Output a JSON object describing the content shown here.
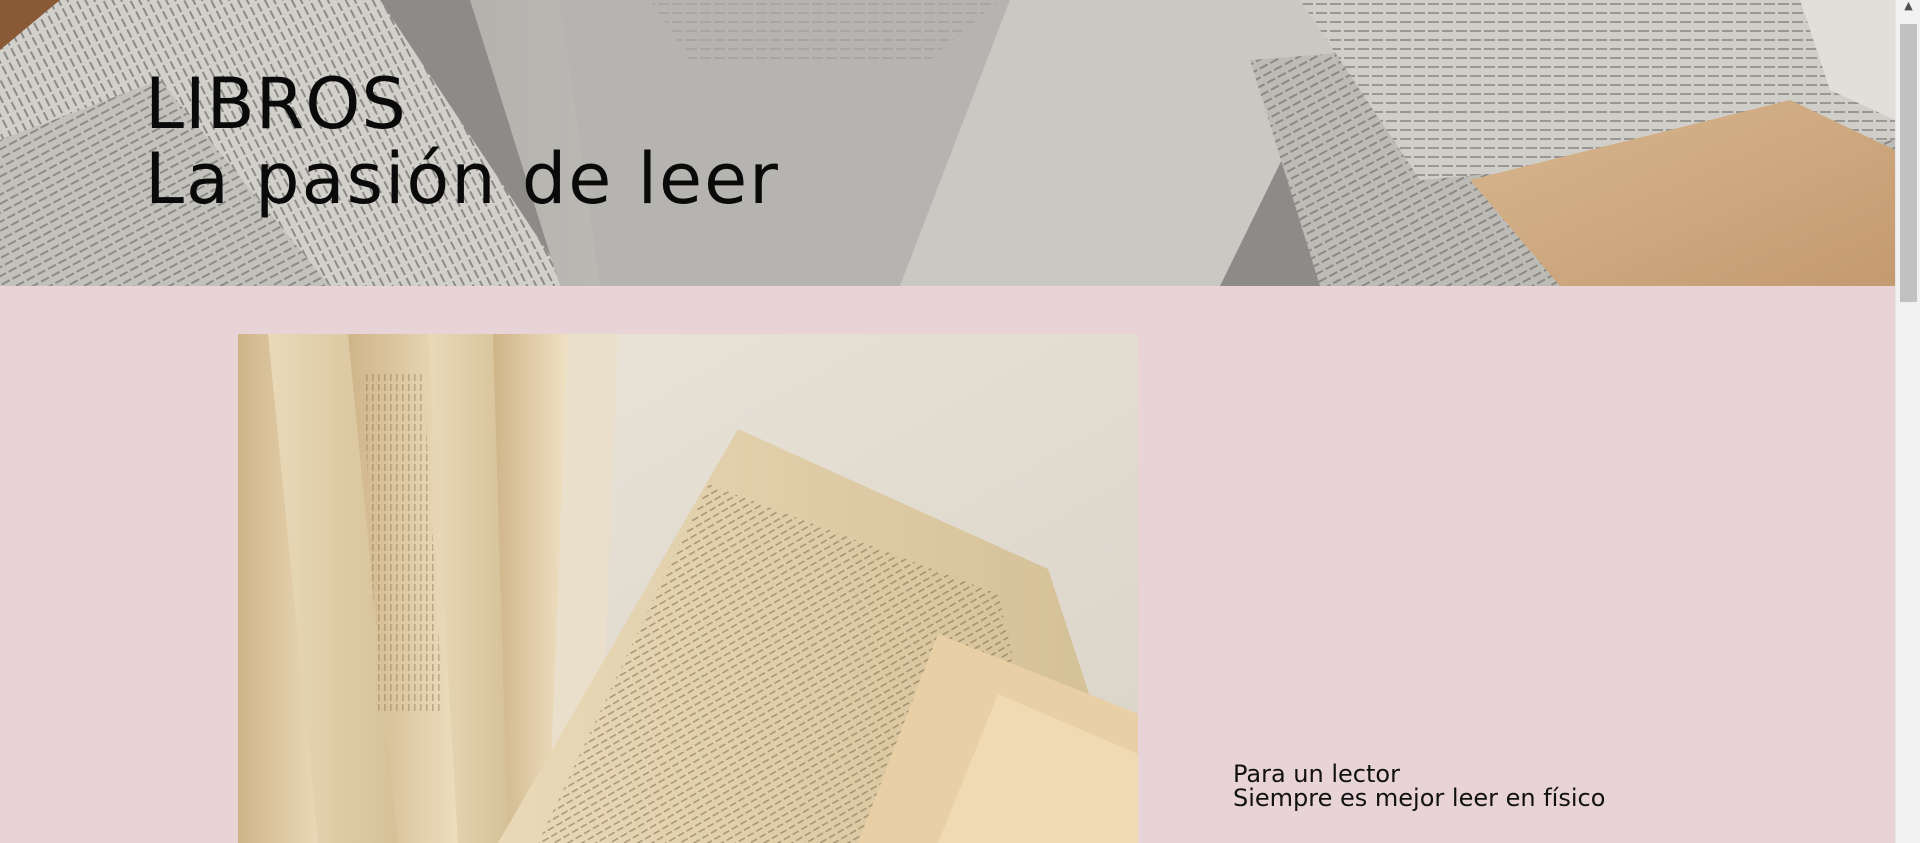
{
  "hero": {
    "title": "LIBROS",
    "subtitle": "La pasión de leer",
    "background_image": "scattered-open-books-photo"
  },
  "main": {
    "background_color": "#e8d4d7",
    "feature_image": "fanned-book-pages-photo",
    "tagline": {
      "line1": "Para un lector",
      "line2": "Siempre es mejor leer en físico"
    }
  },
  "scrollbar": {
    "up_icon": "scroll-up-arrow-icon"
  }
}
